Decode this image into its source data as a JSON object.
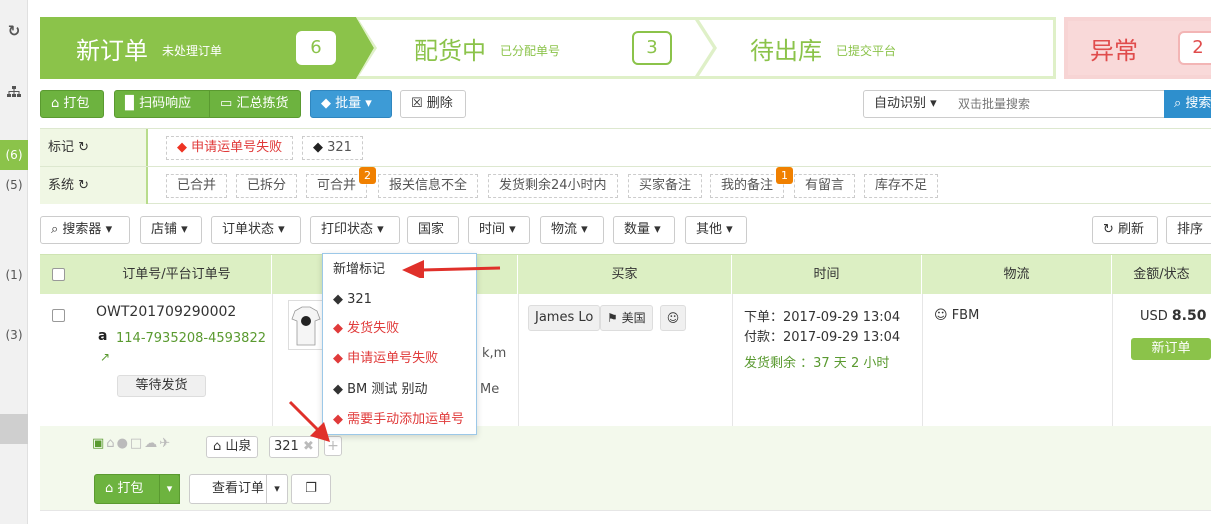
{
  "sidebar": {
    "active_count": "(6)",
    "count_5": "(5)",
    "count_1": "(1)",
    "count_3": "(3)"
  },
  "steps": [
    {
      "title": "新订单",
      "sub": "未处理订单",
      "count": "6"
    },
    {
      "title": "配货中",
      "sub": "已分配单号",
      "count": "3"
    },
    {
      "title": "待出库",
      "sub": "已提交平台",
      "count": ""
    },
    {
      "title": "异常",
      "sub": "",
      "count": "2"
    }
  ],
  "toolbar": {
    "pack": "打包",
    "scan": "扫码响应",
    "summary": "汇总拣货",
    "batch": "批量",
    "delete": "删除",
    "auto_detect": "自动识别",
    "search_placeholder": "双击批量搜索",
    "search_btn": "搜索"
  },
  "filters": {
    "mark_label": "标记",
    "mark_tags": [
      "申请运单号失败",
      "321"
    ],
    "system_label": "系统",
    "system_tags": [
      "已合并",
      "已拆分",
      "可合并",
      "报关信息不全",
      "发货剩余24小时内",
      "买家备注",
      "我的备注",
      "有留言",
      "库存不足"
    ],
    "badge_merge": "2",
    "badge_note": "1"
  },
  "filter_bar": {
    "searcher": "搜索器",
    "shop": "店铺",
    "order_status": "订单状态",
    "print_status": "打印状态",
    "country": "国家",
    "time": "时间",
    "logistics": "物流",
    "quantity": "数量",
    "other": "其他",
    "refresh": "刷新",
    "sort": "排序"
  },
  "table": {
    "headers": [
      "订单号/平台订单号",
      "买家",
      "时间",
      "物流",
      "金额/状态"
    ]
  },
  "order": {
    "order_no": "OWT201709290002",
    "platform_no": "114-7935208-4593822",
    "wait_status": "等待发货",
    "product_text_1": "k,m",
    "product_text_2": "Me",
    "buyer": "James Lo",
    "country": "美国",
    "order_time_label": "下单：",
    "order_time": "2017-09-29 13:04",
    "pay_time_label": "付款：",
    "pay_time": "2017-09-29 13:04",
    "remaining": "发货剩余 ：37 天 2 小时",
    "logistics": "FBM",
    "currency": "USD",
    "amount": "8.50",
    "status": "新订单",
    "warehouse": "山泉",
    "tag": "321",
    "pack": "打包",
    "view": "查看订单"
  },
  "dropdown": {
    "items": [
      "新增标记",
      "321",
      "发货失败",
      "申请运单号失败",
      "BM 测试 别动",
      "需要手动添加运单号"
    ]
  }
}
